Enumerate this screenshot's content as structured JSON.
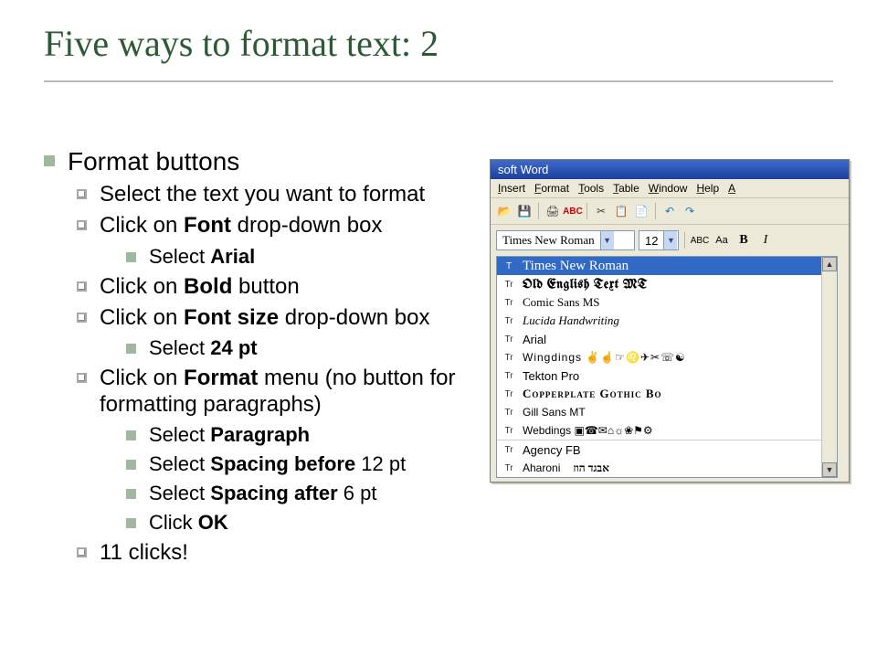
{
  "title": "Five ways to format text: 2",
  "bullets": {
    "h1": "Format buttons",
    "b1": "Select the text you want to format",
    "b2a": "Click on ",
    "b2b": "Font",
    "b2c": " drop-down box",
    "b2_1a": "Select ",
    "b2_1b": "Arial",
    "b3a": "Click on ",
    "b3b": "Bold",
    "b3c": " button",
    "b4a": "Click on ",
    "b4b": "Font size",
    "b4c": " drop-down box",
    "b4_1a": "Select ",
    "b4_1b": "24 pt",
    "b5a": "Click on ",
    "b5b": "Format",
    "b5c": " menu (no button for formatting paragraphs)",
    "b5_1a": "Select ",
    "b5_1b": "Paragraph",
    "b5_2a": "Select ",
    "b5_2b": "Spacing before",
    "b5_2c": " 12 pt",
    "b5_3a": "Select ",
    "b5_3b": "Spacing after",
    "b5_3c": " 6 pt",
    "b5_4a": "Click ",
    "b5_4b": "OK",
    "b6": "11 clicks!"
  },
  "word": {
    "title": "soft Word",
    "menus": [
      "Insert",
      "Format",
      "Tools",
      "Table",
      "Window",
      "Help",
      "A"
    ],
    "font_box": "Times New Roman",
    "size_box": "12",
    "abc": "ABC",
    "aa": "Aa",
    "bold": "B",
    "italic": "I",
    "fonts": [
      {
        "name": "Times New Roman",
        "cls": "f-times",
        "icon": "T",
        "selected": true
      },
      {
        "name": "Old English Text MT",
        "cls": "f-olde",
        "icon": "Tr"
      },
      {
        "name": "Comic Sans MS",
        "cls": "f-comic",
        "icon": "Tr"
      },
      {
        "name": "Lucida Handwriting",
        "cls": "f-lucida",
        "icon": "Tr"
      },
      {
        "name": "Arial",
        "cls": "f-arial",
        "icon": "Tr"
      },
      {
        "name": "Wingdings ✌☝☞♌✈✂☏☯",
        "cls": "f-wing",
        "icon": "Tr"
      },
      {
        "name": "Tekton Pro",
        "cls": "f-tekton",
        "icon": "Tr"
      },
      {
        "name": "Copperplate Gothic Bo",
        "cls": "f-copper",
        "icon": "Tr"
      },
      {
        "name": "Gill Sans MT",
        "cls": "f-gill",
        "icon": "Tr"
      },
      {
        "name": "Webdings ▣☎✉⌂☼❀⚑⚙",
        "cls": "f-web",
        "icon": "Tr",
        "sep": true
      },
      {
        "name": "Agency FB",
        "cls": "f-agency",
        "icon": "Tr"
      },
      {
        "name": "Aharoni",
        "cls": "f-ahar",
        "icon": "Tr",
        "extra": "אבגד הוז"
      }
    ]
  }
}
